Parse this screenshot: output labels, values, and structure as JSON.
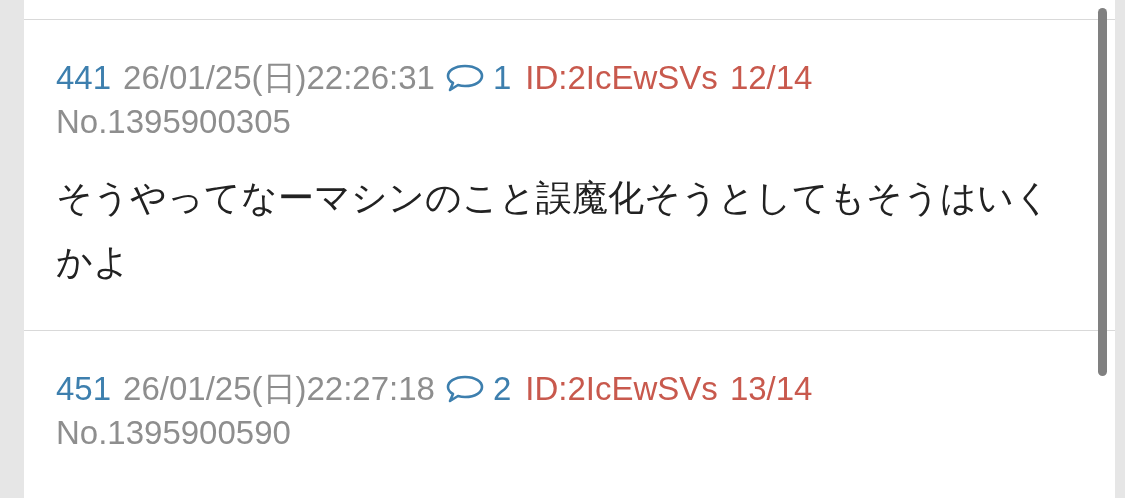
{
  "posts": [
    {
      "number": "441",
      "date": "26/01/25(日)22:26:31",
      "replies": "1",
      "id": "ID:2IcEwSVs",
      "count": "12/14",
      "no": "No.1395900305",
      "body": "そうやってなーマシンのこと誤魔化そうとしてもそうはいくかよ"
    },
    {
      "number": "451",
      "date": "26/01/25(日)22:27:18",
      "replies": "2",
      "id": "ID:2IcEwSVs",
      "count": "13/14",
      "no": "No.1395900590"
    }
  ]
}
